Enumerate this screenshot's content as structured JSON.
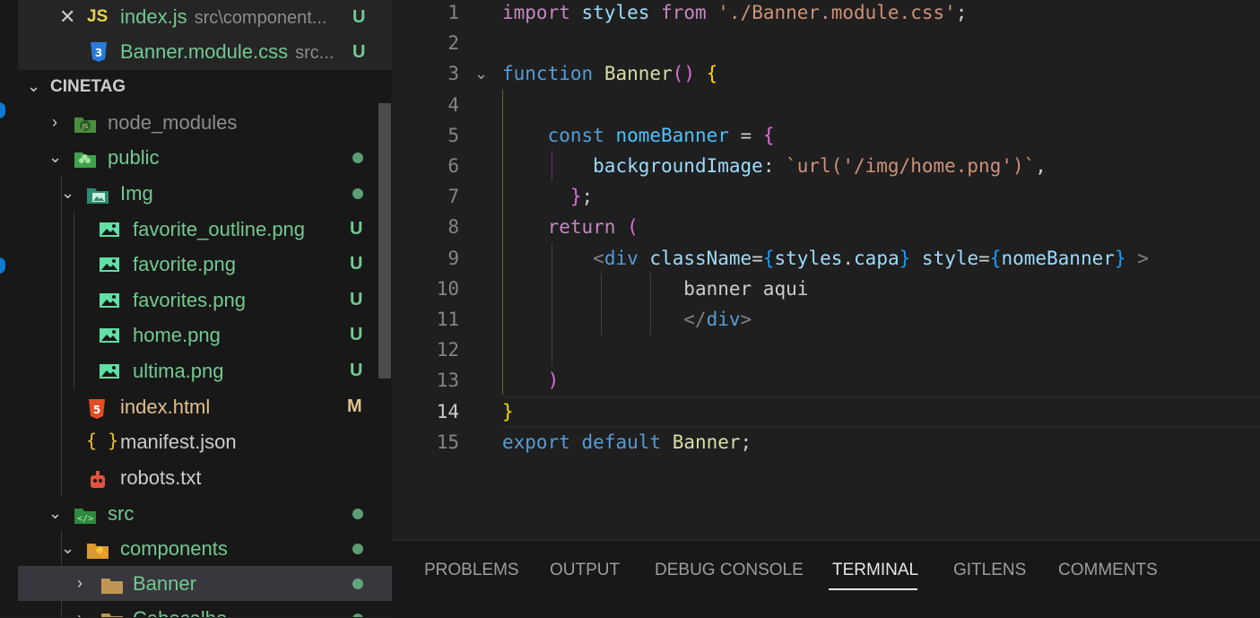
{
  "explorer": {
    "open_editors": [
      {
        "name": "index.js",
        "path": "src\\component...",
        "status": "U",
        "icon": "close-icon"
      },
      {
        "name": "Banner.module.css",
        "path": "src...",
        "status": "U",
        "icon": "css-file-icon"
      }
    ],
    "project_name": "CINETAG",
    "tree": [
      {
        "name": "node_modules",
        "type": "folder",
        "expanded": false,
        "icon": "node-folder-icon"
      },
      {
        "name": "public",
        "type": "folder",
        "expanded": true,
        "icon": "public-folder-icon"
      },
      {
        "name": "Img",
        "type": "folder",
        "expanded": true,
        "icon": "images-folder-icon"
      },
      {
        "name": "favorite_outline.png",
        "type": "file",
        "status": "U",
        "icon": "image-file-icon"
      },
      {
        "name": "favorite.png",
        "type": "file",
        "status": "U",
        "icon": "image-file-icon"
      },
      {
        "name": "favorites.png",
        "type": "file",
        "status": "U",
        "icon": "image-file-icon"
      },
      {
        "name": "home.png",
        "type": "file",
        "status": "U",
        "icon": "image-file-icon"
      },
      {
        "name": "ultima.png",
        "type": "file",
        "status": "U",
        "icon": "image-file-icon"
      },
      {
        "name": "index.html",
        "type": "file",
        "status": "M",
        "icon": "html-file-icon"
      },
      {
        "name": "manifest.json",
        "type": "file",
        "icon": "json-file-icon"
      },
      {
        "name": "robots.txt",
        "type": "file",
        "icon": "robot-file-icon"
      },
      {
        "name": "src",
        "type": "folder",
        "expanded": true,
        "icon": "src-folder-icon"
      },
      {
        "name": "components",
        "type": "folder",
        "expanded": true,
        "icon": "components-folder-icon"
      },
      {
        "name": "Banner",
        "type": "folder",
        "expanded": false,
        "icon": "folder-icon"
      },
      {
        "name": "Cabecalho",
        "type": "folder",
        "expanded": false,
        "icon": "folder-icon"
      }
    ]
  },
  "editor": {
    "current_line": 14,
    "line_numbers": [
      "1",
      "2",
      "3",
      "4",
      "5",
      "6",
      "7",
      "8",
      "9",
      "10",
      "11",
      "12",
      "13",
      "14",
      "15"
    ],
    "lines": {
      "l1": {
        "kw": "import",
        "id": "styles",
        "from": "from",
        "str": "'./Banner.module.css'",
        "end": ";"
      },
      "l3": {
        "kw": "function",
        "name": "Banner",
        "parens": "()",
        "brace": "{"
      },
      "l5": {
        "kw": "const",
        "name": "nomeBanner",
        "eq": "=",
        "brace": "{"
      },
      "l6": {
        "prop": "backgroundImage",
        "colon": ":",
        "str": "`url('/img/home.png')`",
        "end": ","
      },
      "l7": {
        "brace": "}",
        "end": ";"
      },
      "l8": {
        "kw": "return",
        "paren": "("
      },
      "l9": {
        "lt": "<",
        "tag": "div",
        "attr1": "className",
        "eq1": "=",
        "ob1": "{",
        "val1a": "styles",
        "dot": ".",
        "val1b": "capa",
        "cb1": "}",
        "attr2": "style",
        "eq2": "=",
        "ob2": "{",
        "val2": "nomeBanner",
        "cb2": "}",
        "gt": ">"
      },
      "l10": {
        "text": "banner aqui"
      },
      "l11": {
        "lt": "</",
        "tag": "div",
        "gt": ">"
      },
      "l13": {
        "paren": ")"
      },
      "l14": {
        "brace": "}"
      },
      "l15": {
        "kw1": "export",
        "kw2": "default",
        "name": "Banner",
        "end": ";"
      }
    }
  },
  "panel": {
    "tabs": [
      "PROBLEMS",
      "OUTPUT",
      "DEBUG CONSOLE",
      "TERMINAL",
      "GITLENS",
      "COMMENTS"
    ],
    "active_tab": "TERMINAL"
  },
  "colors": {
    "untracked": "#73c991",
    "modified": "#e2c08d",
    "keyword": "#569cd6",
    "control": "#c586c0",
    "string": "#ce9178",
    "function": "#dcdcaa"
  }
}
